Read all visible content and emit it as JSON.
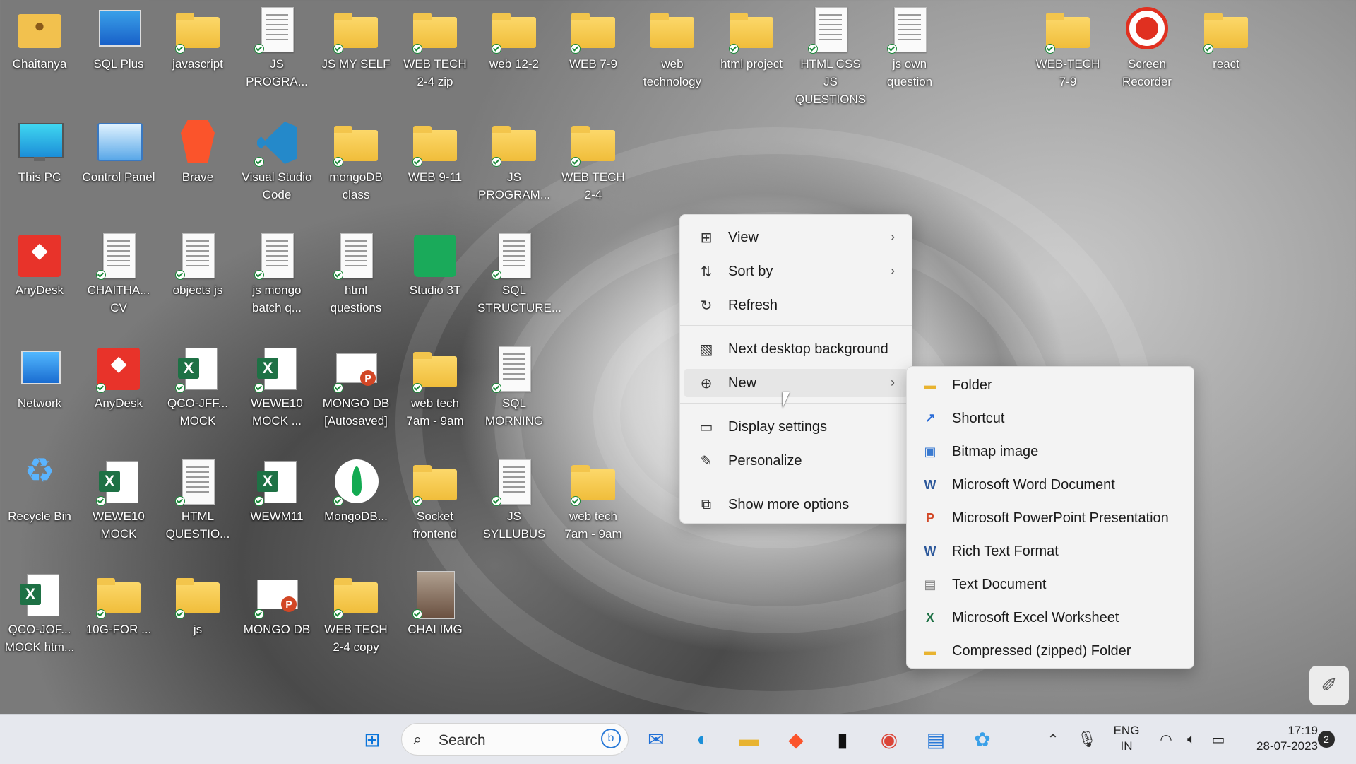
{
  "desktop_icons": [
    {
      "label": "Chaitanya",
      "kind": "person",
      "check": false
    },
    {
      "label": "SQL Plus",
      "kind": "blue",
      "check": false
    },
    {
      "label": "javascript",
      "kind": "folder",
      "check": true
    },
    {
      "label": "JS PROGRA...",
      "kind": "doc",
      "check": true
    },
    {
      "label": "JS MY SELF",
      "kind": "folder",
      "check": true
    },
    {
      "label": "WEB TECH 2-4 zip",
      "kind": "folder",
      "check": true
    },
    {
      "label": "web 12-2",
      "kind": "folder",
      "check": true
    },
    {
      "label": "WEB 7-9",
      "kind": "folder",
      "check": true
    },
    {
      "label": "web technology",
      "kind": "folder",
      "check": false
    },
    {
      "label": "html project",
      "kind": "folder",
      "check": true
    },
    {
      "label": "HTML CSS JS QUESTIONS",
      "kind": "doc",
      "check": true
    },
    {
      "label": "js own question",
      "kind": "doc",
      "check": true
    },
    {
      "label": "WEB-TECH 7-9",
      "kind": "folder",
      "check": true
    },
    {
      "label": "Screen Recorder",
      "kind": "record",
      "check": false
    },
    {
      "label": "react",
      "kind": "folder",
      "check": true
    },
    {
      "label": "This PC",
      "kind": "monitor",
      "check": false
    },
    {
      "label": "Control Panel",
      "kind": "panel",
      "check": false
    },
    {
      "label": "Brave",
      "kind": "brave",
      "check": false
    },
    {
      "label": "Visual Studio Code",
      "kind": "vscode",
      "check": true
    },
    {
      "label": "mongoDB class",
      "kind": "folder",
      "check": true
    },
    {
      "label": "WEB 9-11",
      "kind": "folder",
      "check": true
    },
    {
      "label": "JS PROGRAM...",
      "kind": "folder",
      "check": true
    },
    {
      "label": "WEB TECH 2-4",
      "kind": "folder",
      "check": true
    },
    {
      "label": "AnyDesk",
      "kind": "red",
      "check": false
    },
    {
      "label": "CHAITHA... CV",
      "kind": "doc",
      "check": true
    },
    {
      "label": "objects js",
      "kind": "doc",
      "check": true
    },
    {
      "label": "js mongo batch q...",
      "kind": "doc",
      "check": true
    },
    {
      "label": "html questions",
      "kind": "doc",
      "check": true
    },
    {
      "label": "Studio 3T",
      "kind": "green",
      "check": false
    },
    {
      "label": "SQL STRUCTURE...",
      "kind": "doc",
      "check": true
    },
    {
      "label": "Network",
      "kind": "globe",
      "check": false
    },
    {
      "label": "AnyDesk",
      "kind": "red",
      "check": true
    },
    {
      "label": "QCO-JFF... MOCK",
      "kind": "excel",
      "check": true
    },
    {
      "label": "WEWE10 MOCK ...",
      "kind": "excel",
      "check": true
    },
    {
      "label": "MONGO DB [Autosaved]",
      "kind": "ppt",
      "check": true
    },
    {
      "label": "web tech 7am - 9am",
      "kind": "folder",
      "check": true
    },
    {
      "label": "SQL MORNING",
      "kind": "doc",
      "check": true
    },
    {
      "label": "Recycle Bin",
      "kind": "recycle",
      "check": false
    },
    {
      "label": "WEWE10 MOCK",
      "kind": "excel",
      "check": true
    },
    {
      "label": "HTML QUESTIO...",
      "kind": "doc",
      "check": true
    },
    {
      "label": "WEWM11",
      "kind": "excel",
      "check": true
    },
    {
      "label": "MongoDB...",
      "kind": "mongo",
      "check": true
    },
    {
      "label": "Socket frontend",
      "kind": "folder",
      "check": true
    },
    {
      "label": "JS SYLLUBUS",
      "kind": "doc",
      "check": true
    },
    {
      "label": "web tech 7am - 9am",
      "kind": "folder",
      "check": true
    },
    {
      "label": "QCO-JOF... MOCK htm...",
      "kind": "excel",
      "check": false
    },
    {
      "label": "10G-FOR ...",
      "kind": "folder",
      "check": true
    },
    {
      "label": "js",
      "kind": "folder",
      "check": true
    },
    {
      "label": "MONGO DB",
      "kind": "ppt",
      "check": true
    },
    {
      "label": "WEB TECH 2-4 copy",
      "kind": "folder",
      "check": true
    },
    {
      "label": "CHAI IMG",
      "kind": "photo",
      "check": true
    }
  ],
  "context_menu": {
    "items": [
      {
        "label": "View",
        "icon": "view-grid-icon",
        "glyph": "⊞",
        "submenu": true
      },
      {
        "label": "Sort by",
        "icon": "sort-icon",
        "glyph": "⇅",
        "submenu": true
      },
      {
        "label": "Refresh",
        "icon": "refresh-icon",
        "glyph": "↻",
        "submenu": false
      },
      {
        "label": "Next desktop background",
        "icon": "background-icon",
        "glyph": "▧",
        "submenu": false
      },
      {
        "label": "New",
        "icon": "new-plus-icon",
        "glyph": "⊕",
        "submenu": true
      },
      {
        "label": "Display settings",
        "icon": "display-icon",
        "glyph": "▭",
        "submenu": false
      },
      {
        "label": "Personalize",
        "icon": "brush-icon",
        "glyph": "✎",
        "submenu": false
      },
      {
        "label": "Show more options",
        "icon": "more-options-icon",
        "glyph": "⧉",
        "submenu": false
      }
    ]
  },
  "new_submenu": {
    "items": [
      {
        "label": "Folder",
        "icon": "folder-icon",
        "glyph": "▬",
        "color": "#e8b330"
      },
      {
        "label": "Shortcut",
        "icon": "shortcut-arrow-icon",
        "glyph": "↗",
        "color": "#2a6cd8"
      },
      {
        "label": "Bitmap image",
        "icon": "bitmap-icon",
        "glyph": "▣",
        "color": "#3a7ad0"
      },
      {
        "label": "Microsoft Word Document",
        "icon": "word-icon",
        "glyph": "W",
        "color": "#2b579a"
      },
      {
        "label": "Microsoft PowerPoint Presentation",
        "icon": "powerpoint-icon",
        "glyph": "P",
        "color": "#d24726"
      },
      {
        "label": "Rich Text Format",
        "icon": "rtf-icon",
        "glyph": "W",
        "color": "#2b579a"
      },
      {
        "label": "Text Document",
        "icon": "text-doc-icon",
        "glyph": "▤",
        "color": "#888888"
      },
      {
        "label": "Microsoft Excel Worksheet",
        "icon": "excel-icon",
        "glyph": "X",
        "color": "#1e7145"
      },
      {
        "label": "Compressed (zipped) Folder",
        "icon": "zip-folder-icon",
        "glyph": "▬",
        "color": "#e8b330"
      }
    ]
  },
  "taskbar": {
    "search_placeholder": "Search",
    "apps": [
      {
        "name": "start-button",
        "glyph": "⊞",
        "color": "#0a74da"
      },
      {
        "name": "mail-app-button",
        "glyph": "✉",
        "color": "#1f6fd6"
      },
      {
        "name": "edge-app-button",
        "glyph": "◐",
        "color": "#1a8fd8"
      },
      {
        "name": "file-explorer-button",
        "glyph": "▬",
        "color": "#e8b330"
      },
      {
        "name": "brave-app-button",
        "glyph": "◆",
        "color": "#fb542b"
      },
      {
        "name": "terminal-app-button",
        "glyph": "▮",
        "color": "#111111"
      },
      {
        "name": "chrome-app-button",
        "glyph": "◉",
        "color": "#db4437"
      },
      {
        "name": "notepad-app-button",
        "glyph": "▤",
        "color": "#2a7ad8"
      },
      {
        "name": "paint-app-button",
        "glyph": "✿",
        "color": "#3aa0e8"
      }
    ],
    "lang_line1": "ENG",
    "lang_line2": "IN",
    "time": "17:19",
    "date": "28-07-2023",
    "notification_count": "2"
  }
}
